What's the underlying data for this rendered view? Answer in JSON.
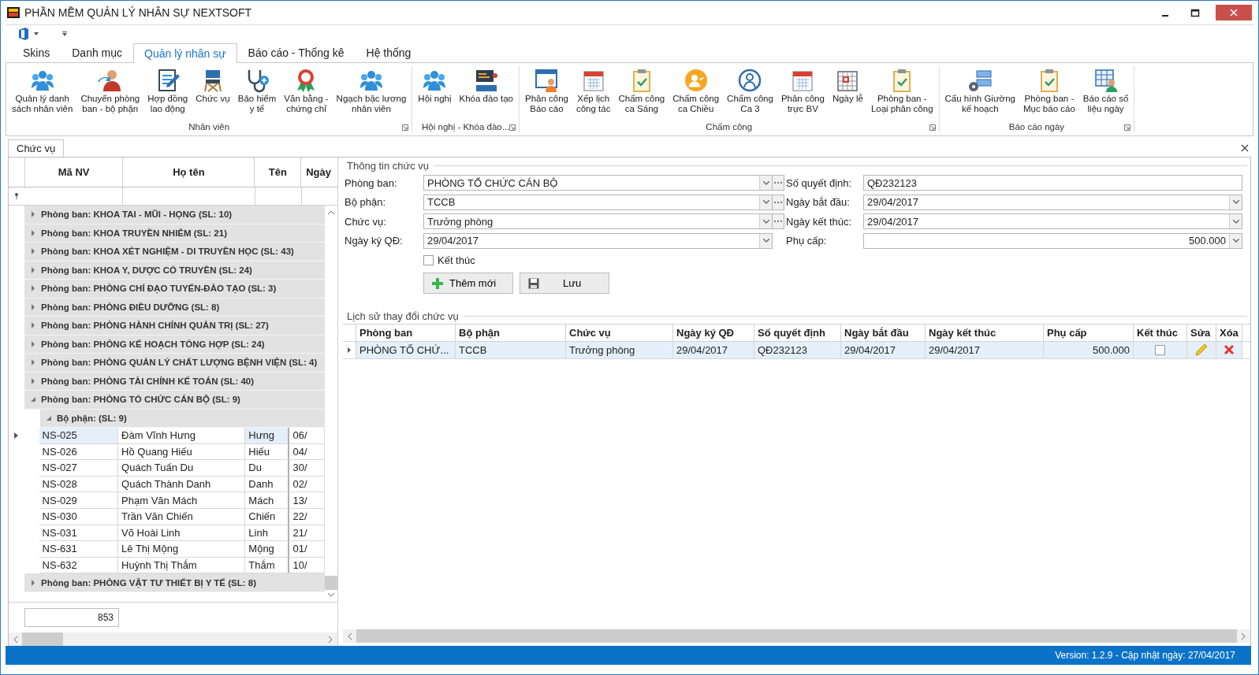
{
  "window": {
    "title": "PHẦN MỀM QUẢN LÝ NHÂN SỰ NEXTSOFT"
  },
  "ribbon_tabs": [
    {
      "label": "Skins",
      "selected": false
    },
    {
      "label": "Danh mục",
      "selected": false
    },
    {
      "label": "Quản lý nhân sự",
      "selected": true
    },
    {
      "label": "Báo cáo - Thống kê",
      "selected": false
    },
    {
      "label": "Hệ thống",
      "selected": false
    }
  ],
  "ribbon_groups": [
    {
      "title": "Nhân viên",
      "items": [
        {
          "lines": [
            "Quản lý danh",
            "sách nhân viên"
          ]
        },
        {
          "lines": [
            "Chuyển phòng",
            "ban - bộ phận"
          ]
        },
        {
          "lines": [
            "Hợp đồng",
            "lao động"
          ]
        },
        {
          "lines": [
            "Chức vụ"
          ]
        },
        {
          "lines": [
            "Bảo hiểm",
            "y tế"
          ]
        },
        {
          "lines": [
            "Văn bằng -",
            "chứng chỉ"
          ]
        },
        {
          "lines": [
            "Ngạch bậc lương",
            "nhân viên"
          ]
        }
      ]
    },
    {
      "title": "Hội nghị - Khóa đào...",
      "items": [
        {
          "lines": [
            "Hội nghị"
          ]
        },
        {
          "lines": [
            "Khóa đào tạo"
          ]
        }
      ]
    },
    {
      "title": "Chấm công",
      "items": [
        {
          "lines": [
            "Phân công",
            "Báo cáo"
          ]
        },
        {
          "lines": [
            "Xếp lịch",
            "công tác"
          ]
        },
        {
          "lines": [
            "Chấm công",
            "ca Sáng"
          ]
        },
        {
          "lines": [
            "Chấm công",
            "ca Chiều"
          ]
        },
        {
          "lines": [
            "Chấm công",
            "Ca 3"
          ]
        },
        {
          "lines": [
            "Phân công",
            "trực BV"
          ]
        },
        {
          "lines": [
            "Ngày lễ"
          ]
        },
        {
          "lines": [
            "Phòng ban -",
            "Loại phân công"
          ]
        }
      ]
    },
    {
      "title": "Báo cáo ngày",
      "items": [
        {
          "lines": [
            "Cấu hình Giường",
            "kế hoạch"
          ]
        },
        {
          "lines": [
            "Phòng ban -",
            "Mục báo cáo"
          ]
        },
        {
          "lines": [
            "Báo cáo số",
            "liệu ngày"
          ]
        }
      ]
    }
  ],
  "document_tab": {
    "label": "Chức vụ",
    "selected": true
  },
  "employee_grid": {
    "columns": [
      "Mã NV",
      "Họ tên",
      "Tên",
      "Ngày"
    ],
    "groups": [
      {
        "label": "Phòng ban: KHOA TAI - MŨI - HỌNG (SL: 10)",
        "expanded": false
      },
      {
        "label": "Phòng ban: KHOA TRUYỀN NHIỄM (SL: 21)",
        "expanded": false
      },
      {
        "label": "Phòng ban: KHOA XÉT NGHIỆM - DI TRUYỀN HỌC (SL: 43)",
        "expanded": false
      },
      {
        "label": "Phòng ban: KHOA Y, DƯỢC CỔ TRUYỀN (SL: 24)",
        "expanded": false
      },
      {
        "label": "Phòng ban: PHÒNG CHỈ ĐẠO TUYẾN-ĐÀO TẠO (SL: 3)",
        "expanded": false
      },
      {
        "label": "Phòng ban: PHÒNG ĐIỀU DƯỠNG (SL: 8)",
        "expanded": false
      },
      {
        "label": "Phòng ban: PHÒNG HÀNH CHÍNH QUẢN TRỊ (SL: 27)",
        "expanded": false
      },
      {
        "label": "Phòng ban: PHÒNG KẾ HOẠCH TỔNG HỢP (SL: 24)",
        "expanded": false
      },
      {
        "label": "Phòng ban: PHÒNG QUẢN LÝ CHẤT LƯỢNG BỆNH VIỆN (SL: 4)",
        "expanded": false
      },
      {
        "label": "Phòng ban: PHÒNG TÀI CHÍNH KẾ TOÁN (SL: 40)",
        "expanded": false
      },
      {
        "label": "Phòng ban: PHÒNG TỔ CHỨC CÁN BỘ (SL: 9)",
        "expanded": true,
        "children": [
          {
            "label": "Bộ phận:  (SL: 9)",
            "expanded": true,
            "rows": [
              {
                "cells": [
                  "NS-025",
                  "Đàm Vĩnh Hưng",
                  "Hưng",
                  "06/"
                ],
                "selected": true
              },
              {
                "cells": [
                  "NS-026",
                  "Hồ Quang Hiếu",
                  "Hiếu",
                  "04/"
                ],
                "selected": false
              },
              {
                "cells": [
                  "NS-027",
                  "Quách Tuấn Du",
                  "Du",
                  "30/"
                ],
                "selected": false
              },
              {
                "cells": [
                  "NS-028",
                  "Quách Thành Danh",
                  "Danh",
                  "02/"
                ],
                "selected": false
              },
              {
                "cells": [
                  "NS-029",
                  "Phạm Văn Mách",
                  "Mách",
                  "13/"
                ],
                "selected": false
              },
              {
                "cells": [
                  "NS-030",
                  "Trần Văn Chiến",
                  "Chiến",
                  "22/"
                ],
                "selected": false
              },
              {
                "cells": [
                  "NS-031",
                  "Võ Hoài Linh",
                  "Linh",
                  "21/"
                ],
                "selected": false
              },
              {
                "cells": [
                  "NS-631",
                  "Lê Thị Mộng",
                  "Mộng",
                  "01/"
                ],
                "selected": false
              },
              {
                "cells": [
                  "NS-632",
                  "Huỳnh Thị Thắm",
                  "Thắm",
                  "10/"
                ],
                "selected": false
              }
            ]
          }
        ]
      },
      {
        "label": "Phòng ban: PHÒNG VẬT TƯ THIẾT BỊ Y TẾ (SL: 8)",
        "expanded": false
      }
    ],
    "footer_count": "853"
  },
  "position_form": {
    "title": "Thông tin chức vụ",
    "left_fields": [
      {
        "label": "Phòng ban:",
        "value": "PHÒNG TỔ CHỨC CÁN BỘ",
        "kind": "lookup"
      },
      {
        "label": "Bộ phận:",
        "value": "TCCB",
        "kind": "lookup"
      },
      {
        "label": "Chức vụ:",
        "value": "Trưởng phòng",
        "kind": "lookup"
      },
      {
        "label": "Ngày ký QĐ:",
        "value": "29/04/2017",
        "kind": "date"
      }
    ],
    "right_fields": [
      {
        "label": "Số quyết định:",
        "value": "QĐ232123",
        "kind": "text"
      },
      {
        "label": "Ngày bắt đầu:",
        "value": "29/04/2017",
        "kind": "date"
      },
      {
        "label": "Ngày kết thúc:",
        "value": "29/04/2017",
        "kind": "date"
      },
      {
        "label": "Phụ cấp:",
        "value": "500.000",
        "kind": "number"
      }
    ],
    "ended": {
      "label": "Kết thúc",
      "checked": false
    },
    "buttons": [
      {
        "label": "Thêm mới",
        "kind": "add"
      },
      {
        "label": "Lưu",
        "kind": "save"
      }
    ]
  },
  "history": {
    "title": "Lịch sử thay đổi chức vụ",
    "columns": [
      "Phòng ban",
      "Bộ phận",
      "Chức vụ",
      "Ngày ký QĐ",
      "Số quyết định",
      "Ngày bắt đầu",
      "Ngày kết thúc",
      "Phụ cấp",
      "Kết thúc",
      "Sửa",
      "Xóa"
    ],
    "rows": [
      {
        "cells": [
          "PHÒNG TỐ CHỨ...",
          "TCCB",
          "Trưởng phòng",
          "29/04/2017",
          "QĐ232123",
          "29/04/2017",
          "29/04/2017",
          "500.000"
        ],
        "ended": false,
        "selected": true
      }
    ]
  },
  "status_bar": {
    "text": "Version: 1.2.9 - Cập nhật ngày: 27/04/2017"
  }
}
